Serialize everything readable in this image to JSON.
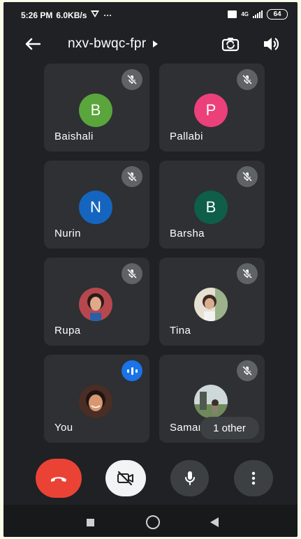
{
  "status_bar": {
    "time": "5:26 PM",
    "speed": "6.0KB/s",
    "more": "···",
    "network": "4G",
    "battery": "64"
  },
  "header": {
    "meeting_code": "nxv-bwqc-fpr",
    "back_icon": "arrow-left-icon",
    "switch_camera_icon": "switch-camera-icon",
    "speaker_icon": "speaker-icon"
  },
  "participants": [
    {
      "name": "Baishali",
      "initial": "B",
      "color": "#5aa53c",
      "muted": true
    },
    {
      "name": "Pallabi",
      "initial": "P",
      "color": "#ec407a",
      "muted": true
    },
    {
      "name": "Nurin",
      "initial": "N",
      "color": "#1565c0",
      "muted": true
    },
    {
      "name": "Barsha",
      "initial": "B",
      "color": "#0e5e4a",
      "muted": true
    },
    {
      "name": "Rupa",
      "initial": "",
      "color": "#b7474e",
      "muted": true,
      "photo": true
    },
    {
      "name": "Tina",
      "initial": "",
      "color": "#cdbfa6",
      "muted": true,
      "photo": true
    },
    {
      "name": "You",
      "initial": "",
      "color": "#7a4b3a",
      "muted": false,
      "speaking": true,
      "photo": true
    },
    {
      "name": "Saman",
      "initial": "",
      "color": "#7f9a6c",
      "muted": true,
      "photo": true
    }
  ],
  "others_pill": "1 other",
  "colors": {
    "end_call": "#ea4335",
    "speaking": "#1a73e8",
    "tile_bg": "#2e3033",
    "background": "#1f2124"
  }
}
